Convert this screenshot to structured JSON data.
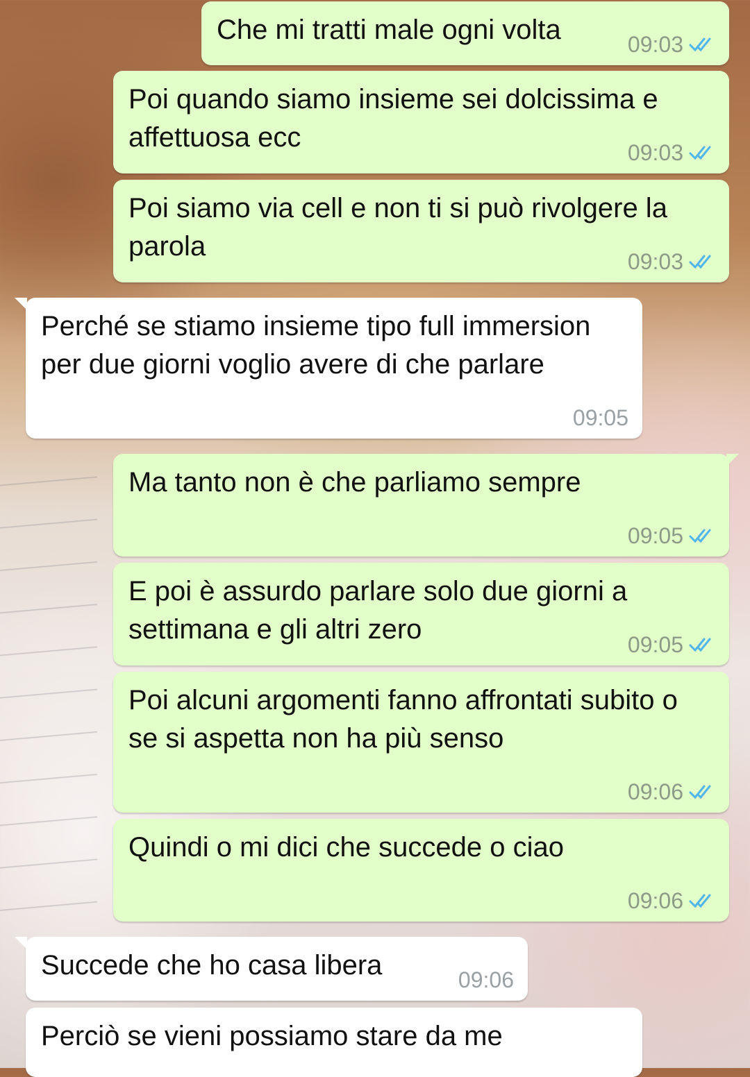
{
  "colors": {
    "outgoing_bubble": "#e2fec9",
    "incoming_bubble": "#ffffff",
    "read_ticks": "#4fb6ec",
    "timestamp": "#8c9a88"
  },
  "messages": [
    {
      "text": "Che mi tratti male ogni volta",
      "time": "09:03",
      "direction": "outgoing",
      "status_icon": "double-check-read-icon"
    },
    {
      "text": "Poi quando siamo insieme sei dolcissima e affettuosa ecc",
      "time": "09:03",
      "direction": "outgoing",
      "status_icon": "double-check-read-icon"
    },
    {
      "text": "Poi siamo via cell e non ti si può rivolgere la parola",
      "time": "09:03",
      "direction": "outgoing",
      "status_icon": "double-check-read-icon"
    },
    {
      "text": "Perché se stiamo insieme tipo full immersion per due giorni voglio avere di che parlare",
      "time": "09:05",
      "direction": "incoming"
    },
    {
      "text": "Ma tanto non è che parliamo sempre",
      "time": "09:05",
      "direction": "outgoing",
      "status_icon": "double-check-read-icon"
    },
    {
      "text": "E poi è assurdo parlare solo due giorni a settimana e gli altri zero",
      "time": "09:05",
      "direction": "outgoing",
      "status_icon": "double-check-read-icon"
    },
    {
      "text": "Poi alcuni argomenti fanno affrontati subito o se si aspetta non ha più senso",
      "time": "09:06",
      "direction": "outgoing",
      "status_icon": "double-check-read-icon"
    },
    {
      "text": "Quindi o mi dici che succede o ciao",
      "time": "09:06",
      "direction": "outgoing",
      "status_icon": "double-check-read-icon"
    },
    {
      "text": "Succede che ho casa libera",
      "time": "09:06",
      "direction": "incoming"
    },
    {
      "text": "Perciò se vieni possiamo stare da me",
      "direction": "incoming"
    }
  ]
}
